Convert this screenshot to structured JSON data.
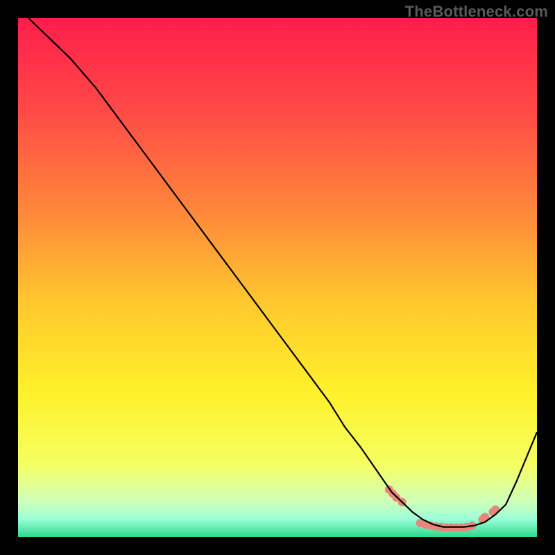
{
  "watermark": "TheBottleneck.com",
  "gradient": {
    "stops": [
      {
        "offset": 0.0,
        "color": "#ff1d4a"
      },
      {
        "offset": 0.18,
        "color": "#ff4a47"
      },
      {
        "offset": 0.38,
        "color": "#ff8a3a"
      },
      {
        "offset": 0.55,
        "color": "#ffc92e"
      },
      {
        "offset": 0.72,
        "color": "#fff12a"
      },
      {
        "offset": 0.86,
        "color": "#f5ff62"
      },
      {
        "offset": 0.93,
        "color": "#d1ffb8"
      },
      {
        "offset": 0.965,
        "color": "#9cffd8"
      },
      {
        "offset": 1.0,
        "color": "#2bd98e"
      }
    ]
  },
  "chart_data": {
    "type": "line",
    "title": "",
    "xlabel": "",
    "ylabel": "",
    "xlim": [
      0,
      100
    ],
    "ylim": [
      0,
      104
    ],
    "series": [
      {
        "name": "bottleneck-curve",
        "stroke": "#000000",
        "x": [
          2,
          6,
          10,
          15,
          20,
          25,
          30,
          35,
          40,
          45,
          50,
          55,
          60,
          63,
          66,
          70,
          72,
          74,
          76,
          78,
          80,
          82,
          84,
          86,
          88,
          90,
          92,
          94,
          96,
          98,
          100
        ],
        "y": [
          104,
          100,
          96,
          90,
          83,
          76,
          69,
          62,
          55,
          48,
          41,
          34,
          27,
          22,
          18,
          12,
          9,
          7,
          5,
          3.5,
          2.5,
          2,
          2,
          2,
          2.3,
          3,
          4.5,
          6.5,
          11,
          16,
          21
        ]
      }
    ],
    "markers": {
      "name": "salmon-dots",
      "fill": "#e98579",
      "points": [
        {
          "x": 71.5,
          "y": 9.5
        },
        {
          "x": 72.2,
          "y": 8.7
        },
        {
          "x": 72.9,
          "y": 7.9
        },
        {
          "x": 74.0,
          "y": 7.0
        },
        {
          "x": 77.5,
          "y": 2.8
        },
        {
          "x": 78.5,
          "y": 2.5
        },
        {
          "x": 79.5,
          "y": 2.3
        },
        {
          "x": 80.5,
          "y": 2.1
        },
        {
          "x": 81.5,
          "y": 2.0
        },
        {
          "x": 82.5,
          "y": 1.9
        },
        {
          "x": 83.5,
          "y": 1.9
        },
        {
          "x": 84.5,
          "y": 1.9
        },
        {
          "x": 85.5,
          "y": 1.9
        },
        {
          "x": 86.5,
          "y": 2.0
        },
        {
          "x": 87.5,
          "y": 2.3
        },
        {
          "x": 89.5,
          "y": 3.5
        },
        {
          "x": 90.0,
          "y": 4.0
        },
        {
          "x": 91.5,
          "y": 5.0
        },
        {
          "x": 92.0,
          "y": 5.5
        }
      ]
    }
  }
}
